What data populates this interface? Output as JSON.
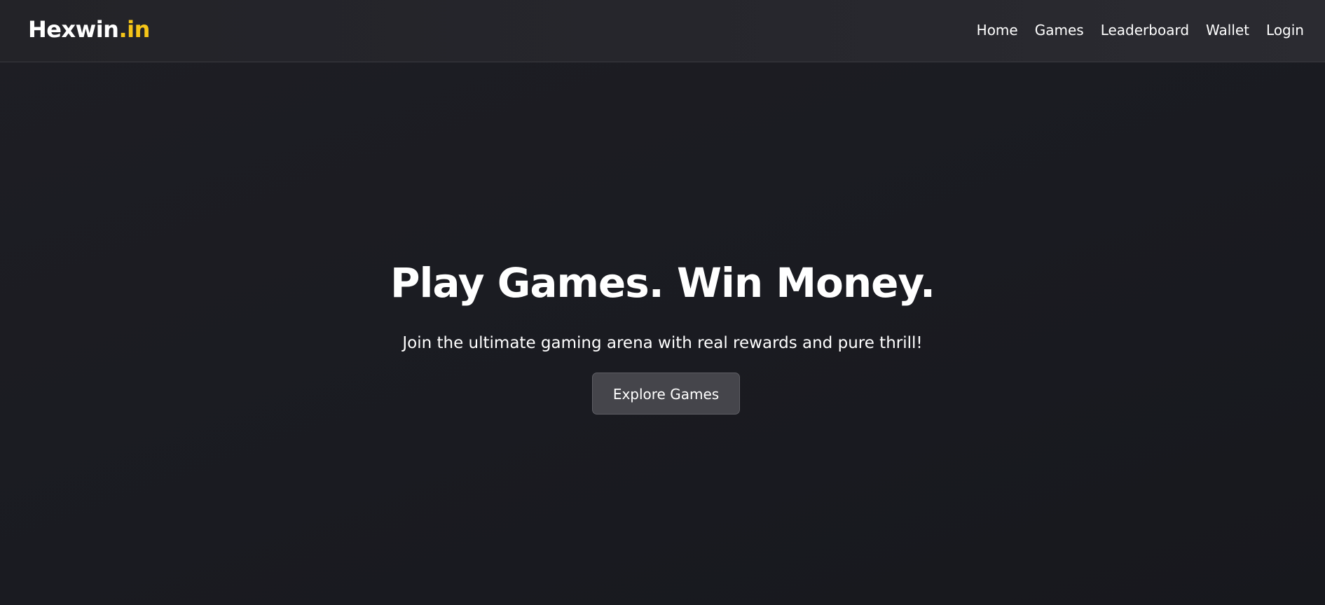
{
  "brand": {
    "main": "Hexwin",
    "accent": ".in",
    "accent_color": "#f5c518"
  },
  "nav": {
    "items": [
      {
        "label": "Home"
      },
      {
        "label": "Games"
      },
      {
        "label": "Leaderboard"
      },
      {
        "label": "Wallet"
      },
      {
        "label": "Login"
      }
    ]
  },
  "hero": {
    "title": "Play Games. Win Money.",
    "subtitle": "Join the ultimate gaming arena with real rewards and pure thrill!",
    "cta_label": "Explore Games"
  },
  "colors": {
    "background": "#1b1b21",
    "navbar": "#26262c",
    "button": "#45454b",
    "text": "#ffffff"
  }
}
